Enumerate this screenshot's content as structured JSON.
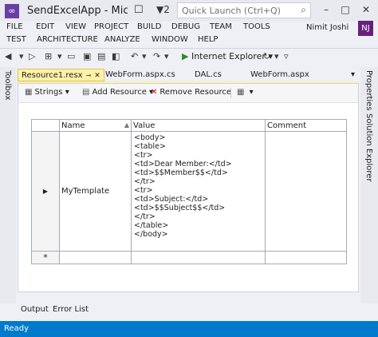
{
  "window": {
    "title": "SendExcelApp - Micr",
    "notif_count": "2",
    "quick_launch_placeholder": "Quick Launch (Ctrl+Q)",
    "user_name": "Nimit Joshi",
    "user_initials": "NJ"
  },
  "menu": {
    "row1": [
      "FILE",
      "EDIT",
      "VIEW",
      "PROJECT",
      "BUILD",
      "DEBUG",
      "TEAM",
      "TOOLS"
    ],
    "row2": [
      "TEST",
      "ARCHITECTURE",
      "ANALYZE",
      "WINDOW",
      "HELP"
    ]
  },
  "toolbar": {
    "run_target": "Internet Explorer"
  },
  "side": {
    "left": "Toolbox",
    "right_top": "Properties",
    "right_bottom": "Solution Explorer"
  },
  "tabs": [
    {
      "label": "Resource1.resx",
      "active": true
    },
    {
      "label": "WebForm.aspx.cs",
      "active": false
    },
    {
      "label": "DAL.cs",
      "active": false
    },
    {
      "label": "WebForm.aspx",
      "active": false
    }
  ],
  "resource_toolbar": {
    "strings": "Strings",
    "add_resource": "Add Resource",
    "remove_resource": "Remove Resource"
  },
  "grid": {
    "columns": [
      "Name",
      "Value",
      "Comment"
    ],
    "rows": [
      {
        "name": "MyTemplate",
        "value_lines": [
          "<body>",
          "<table>",
          "<tr>",
          "<td>Dear Member:</td>",
          "<td>$$Member$$</td>",
          "</tr>",
          "<tr>",
          "<td>Subject:</td>",
          "<td>$$Subject$$</td>",
          "</tr>",
          "</table>",
          "</body>"
        ],
        "comment": ""
      }
    ],
    "new_row_marker": "*"
  },
  "bottom_tabs": [
    "Output",
    "Error List"
  ],
  "status": "Ready",
  "colors": {
    "accent": "#007acc",
    "active_tab": "#fff1a8",
    "vs_logo": "#6a3fa5",
    "avatar": "#68217a"
  }
}
